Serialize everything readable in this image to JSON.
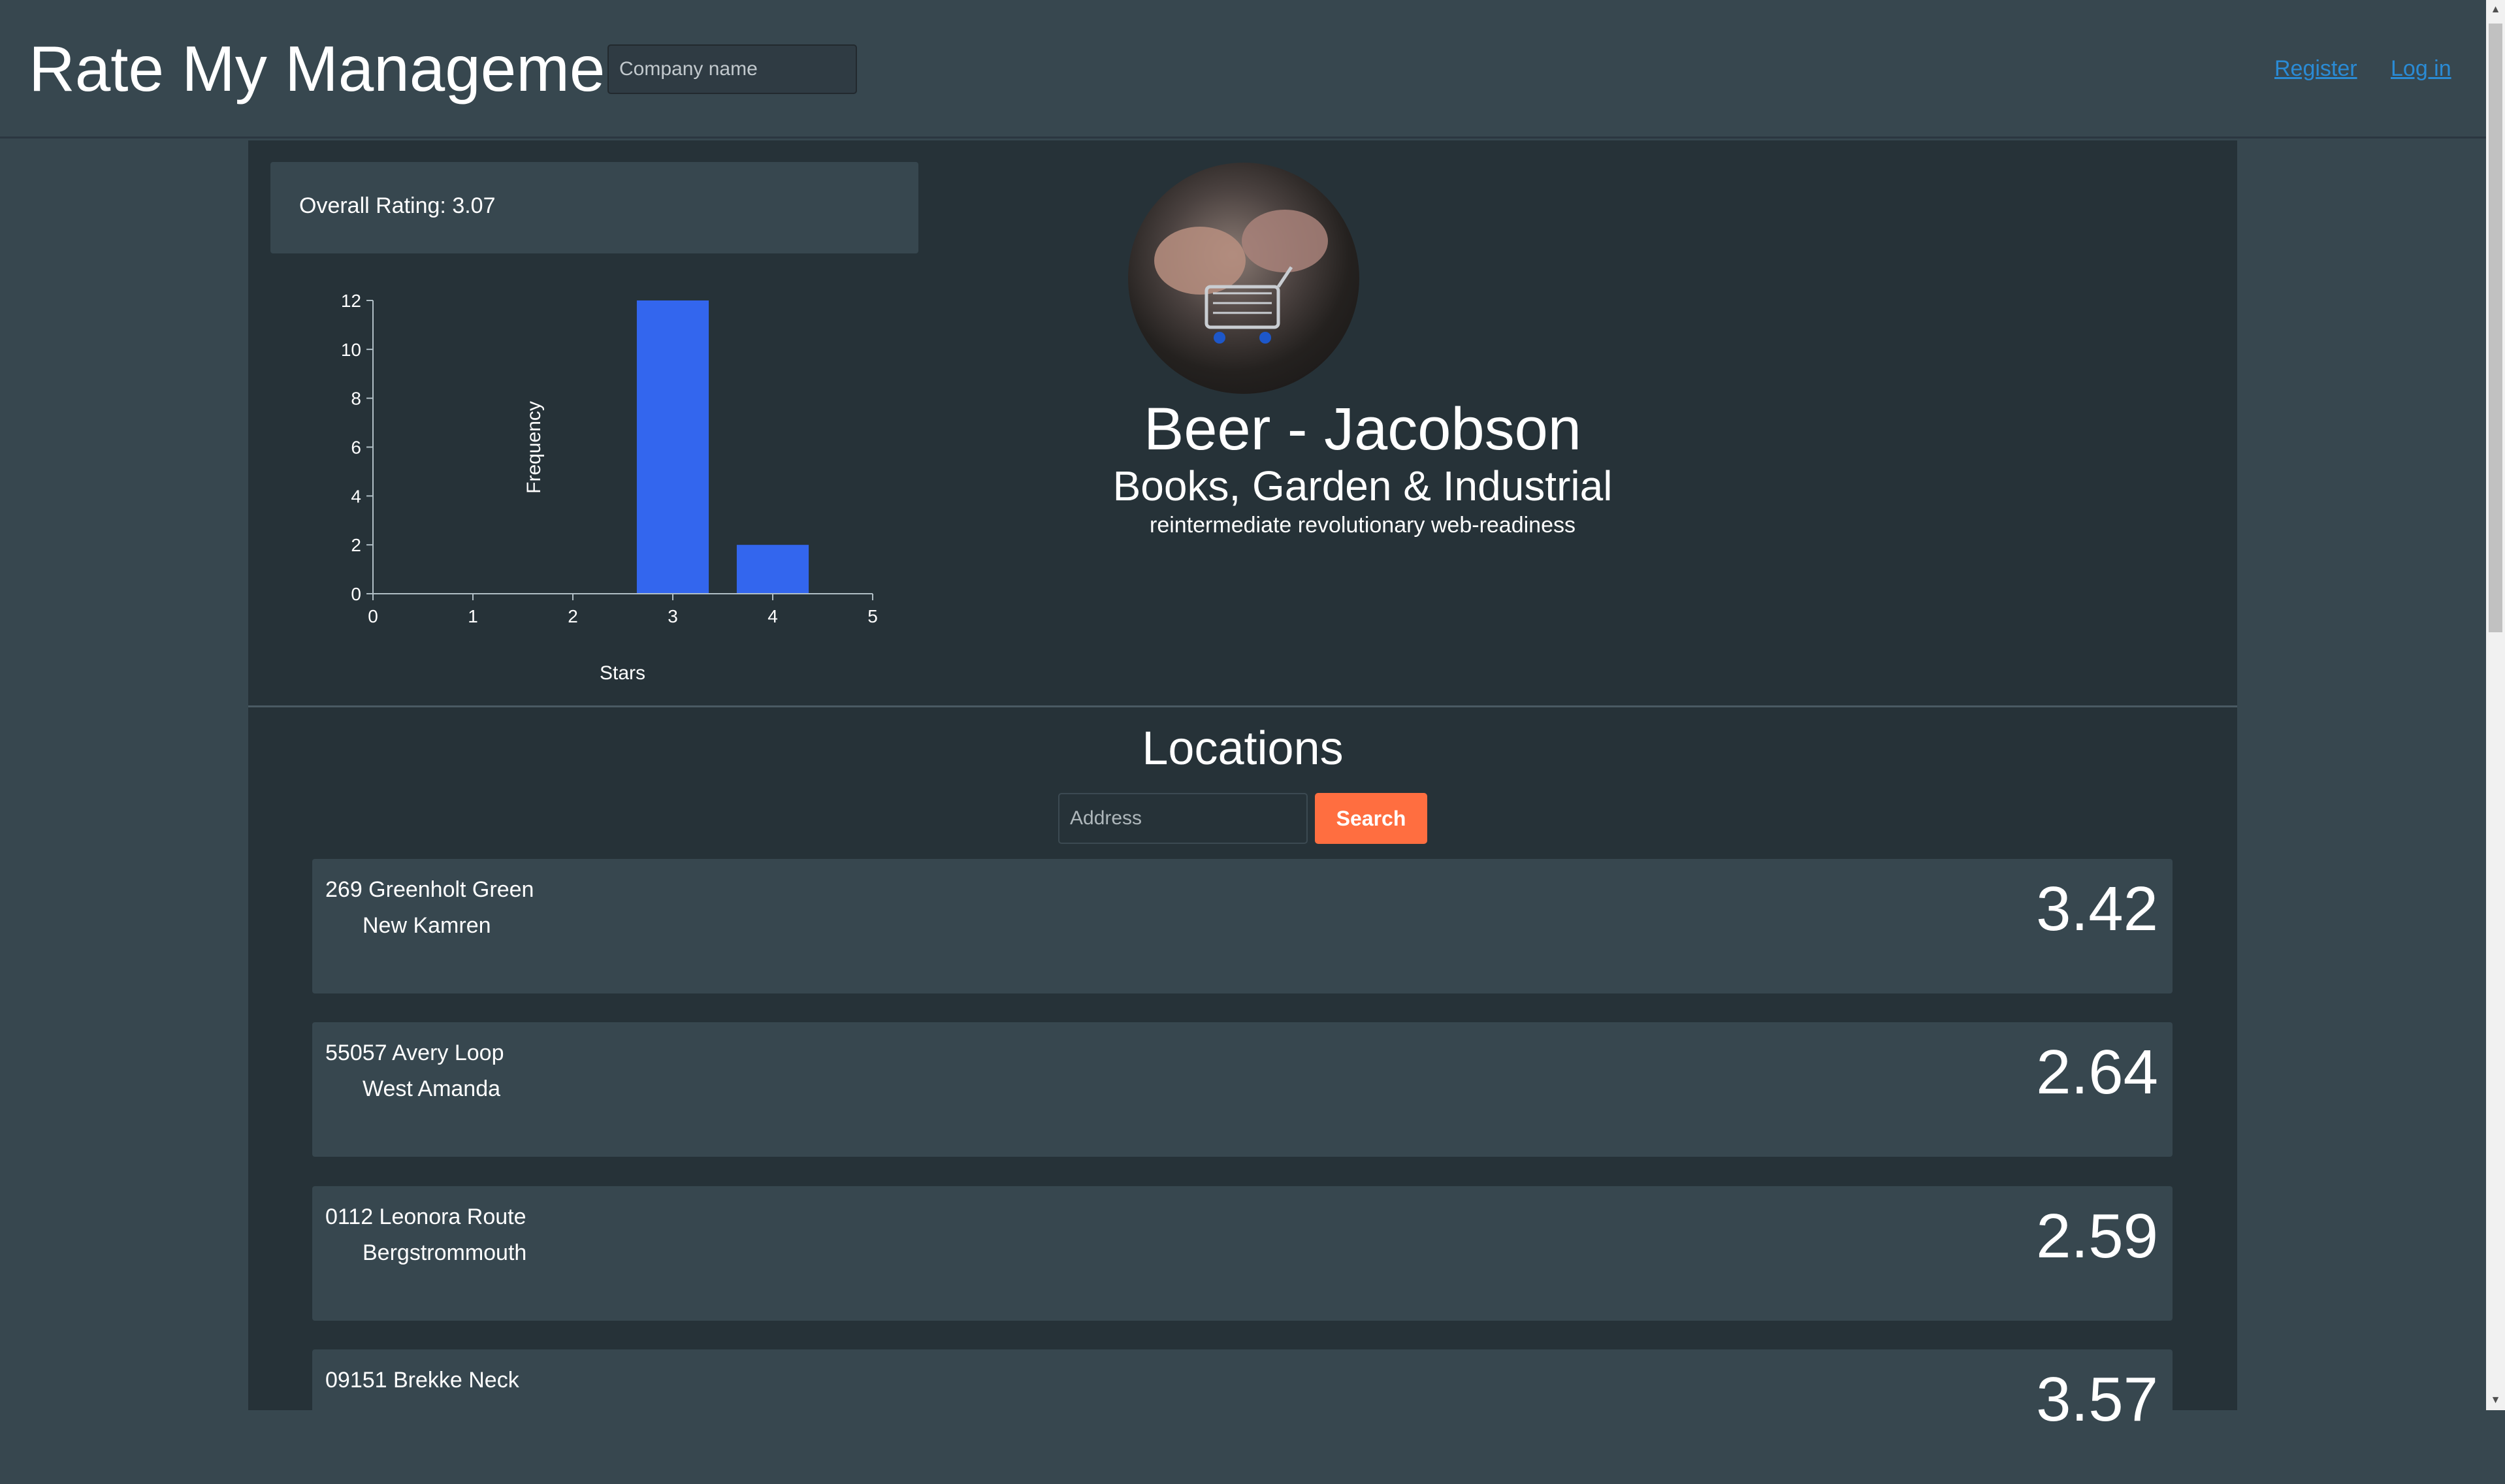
{
  "header": {
    "brand": "Rate My Management",
    "search_placeholder": "Company name",
    "register_label": "Register",
    "login_label": "Log in"
  },
  "rating": {
    "overall_label": "Overall Rating: 3.07"
  },
  "company": {
    "name": "Beer - Jacobson",
    "category": "Books, Garden & Industrial",
    "tagline": "reintermediate revolutionary web-readiness"
  },
  "locations": {
    "title": "Locations",
    "address_placeholder": "Address",
    "search_label": "Search",
    "items": [
      {
        "address": "269 Greenholt Green",
        "city": "New Kamren",
        "score": "3.42"
      },
      {
        "address": "55057 Avery Loop",
        "city": "West Amanda",
        "score": "2.64"
      },
      {
        "address": "0112 Leonora Route",
        "city": "Bergstrommouth",
        "score": "2.59"
      },
      {
        "address": "09151 Brekke Neck",
        "city": "",
        "score": "3.57"
      }
    ]
  },
  "colors": {
    "page_bg": "#37474f",
    "main_bg": "#263238",
    "bar": "#3366ee",
    "accent": "#ff6e40",
    "link": "#2a8bd5"
  },
  "chart_data": {
    "type": "bar",
    "xlabel": "Stars",
    "ylabel": "Frequency",
    "x_ticks": [
      "0",
      "1",
      "2",
      "3",
      "4",
      "5"
    ],
    "y_ticks": [
      "0",
      "2",
      "4",
      "6",
      "8",
      "10",
      "12"
    ],
    "xlim": [
      0,
      5
    ],
    "ylim": [
      0,
      12
    ],
    "bars": [
      {
        "x": 3,
        "value": 12
      },
      {
        "x": 4,
        "value": 2
      }
    ]
  }
}
